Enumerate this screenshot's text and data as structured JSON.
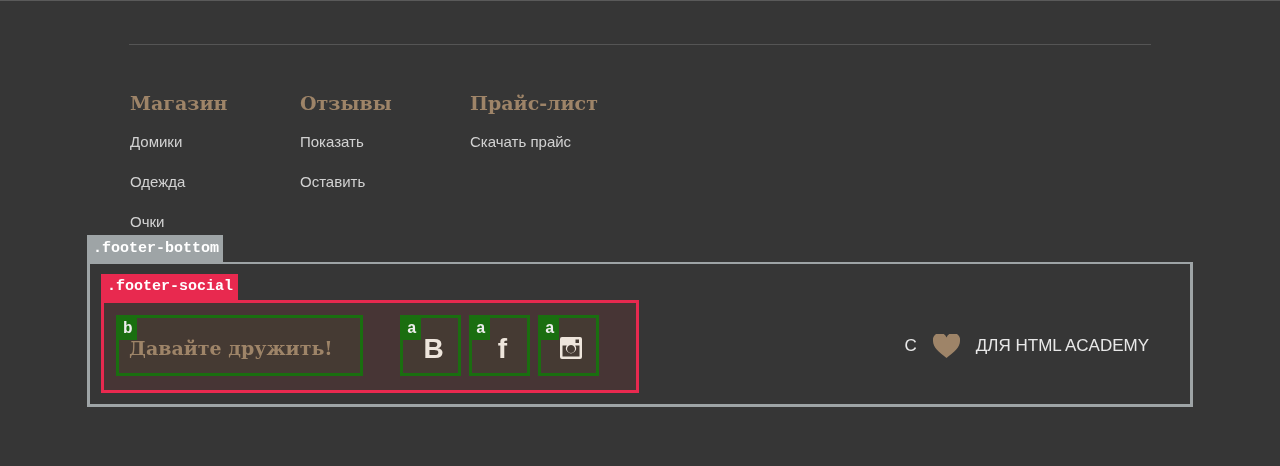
{
  "nav_columns": [
    {
      "heading": "Магазин",
      "links": [
        "Домики",
        "Одежда",
        "Очки"
      ]
    },
    {
      "heading": "Отзывы",
      "links": [
        "Показать",
        "Оставить"
      ]
    },
    {
      "heading": "Прайс-лист",
      "links": [
        "Скачать прайс"
      ]
    }
  ],
  "footer_bottom": {
    "tag": ".footer-bottom",
    "social": {
      "tag": ".footer-social",
      "title": {
        "tag": "b",
        "text": "Давайте дружить!"
      },
      "links": [
        {
          "tag": "a",
          "kind": "glyph",
          "glyph": "B"
        },
        {
          "tag": "a",
          "kind": "glyph",
          "glyph": "f"
        },
        {
          "tag": "a",
          "kind": "instagram"
        }
      ]
    },
    "credit": {
      "prefix": "С",
      "suffix": "ДЛЯ HTML ACADEMY"
    }
  }
}
